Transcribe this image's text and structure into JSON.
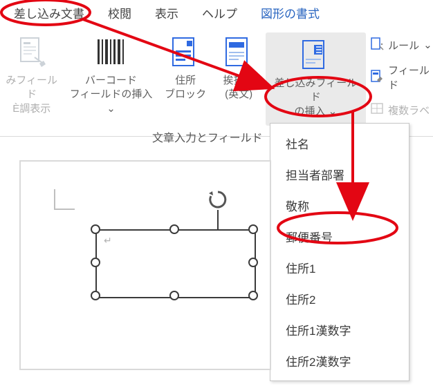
{
  "tabs": {
    "mailmerge": "差し込み文書",
    "review": "校閲",
    "view": "表示",
    "help": "ヘルプ",
    "shape_format": "図形の書式"
  },
  "ribbon": {
    "merge_field_highlight_l1": "みフィールド",
    "merge_field_highlight_l2": "È調表示",
    "barcode_l1": "バーコード",
    "barcode_l2": "フィールドの挿入",
    "address_l1": "住所",
    "address_l2": "ブロック",
    "greeting_l1": "挨拶文",
    "greeting_l2": "(英文)",
    "insert_field_l1": "差し込みフィールド",
    "insert_field_l2": "の挿入",
    "caret": "⌄"
  },
  "mini": {
    "rules": "ルール",
    "field_match": "フィールド",
    "multi_labels": "複数ラベ"
  },
  "group_name": "文章入力とフィールド",
  "menu": {
    "company": "社名",
    "dept": "担当者部署",
    "title": "敬称",
    "postal": "郵便番号",
    "addr1": "住所1",
    "addr2": "住所2",
    "addr1k": "住所1漢数字",
    "addr2k": "住所2漢数字"
  },
  "colors": {
    "annotation": "#e30613",
    "grid": "#2f6ae1"
  },
  "paragraph_mark": "↵"
}
